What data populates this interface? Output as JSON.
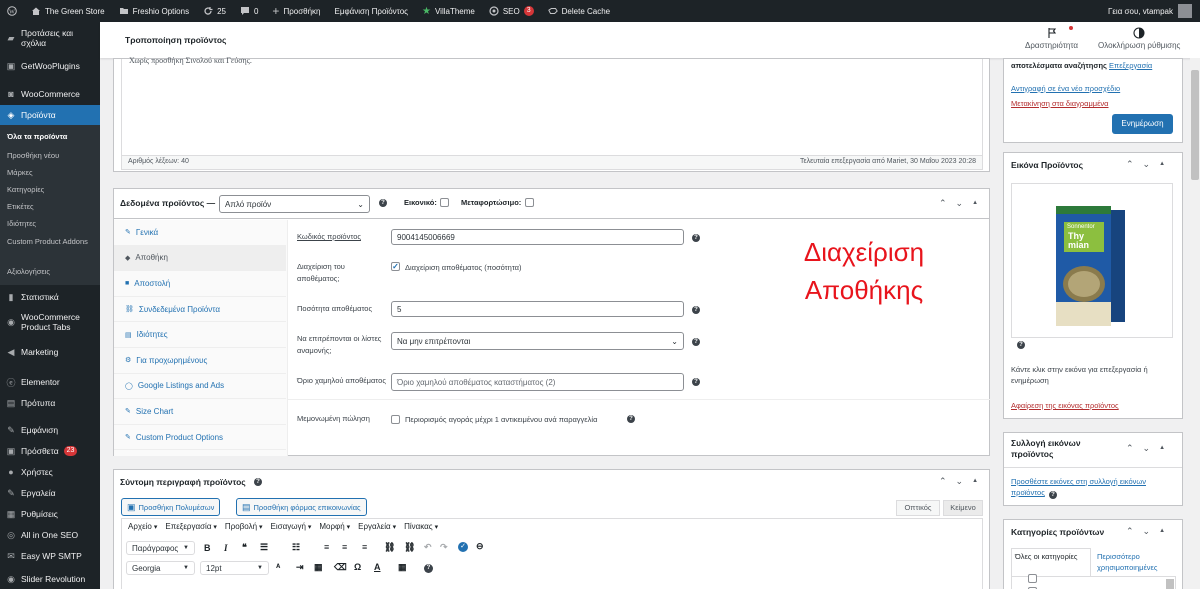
{
  "adminbar": {
    "site": "The Green Store",
    "freshio": "Freshio Options",
    "updates": "25",
    "comments": "0",
    "new": "Προσθήκη",
    "view": "Εμφάνιση Προϊόντος",
    "villa": "VillaTheme",
    "seo": "SEO",
    "seo_count": "3",
    "cache": "Delete Cache",
    "howdy": "Γεια σου, vtampak"
  },
  "sidebar": {
    "items": [
      {
        "label": "Προτάσεις και σχόλια",
        "icon": "comment-icon"
      },
      {
        "label": "GetWooPlugins",
        "icon": "plugin-icon"
      },
      {
        "label": "WooCommerce",
        "icon": "woo-icon"
      },
      {
        "label": "Προϊόντα",
        "icon": "products-icon"
      },
      {
        "label": "Στατιστικά",
        "icon": "chart-icon"
      },
      {
        "label": "WooCommerce Product Tabs",
        "icon": "tabs-icon"
      },
      {
        "label": "Marketing",
        "icon": "megaphone-icon"
      },
      {
        "label": "Elementor",
        "icon": "elementor-icon"
      },
      {
        "label": "Πρότυπα",
        "icon": "folder-icon"
      },
      {
        "label": "Εμφάνιση",
        "icon": "brush-icon"
      },
      {
        "label": "Πρόσθετα",
        "icon": "plugin-icon",
        "badge": "23"
      },
      {
        "label": "Χρήστες",
        "icon": "users-icon"
      },
      {
        "label": "Εργαλεία",
        "icon": "wrench-icon"
      },
      {
        "label": "Ρυθμίσεις",
        "icon": "settings-icon"
      },
      {
        "label": "All in One SEO",
        "icon": "seo-icon"
      },
      {
        "label": "Easy WP SMTP",
        "icon": "mail-icon"
      },
      {
        "label": "Slider Revolution",
        "icon": "slider-icon"
      }
    ],
    "submenu": [
      "Όλα τα προϊόντα",
      "Προσθήκη νέου",
      "Μάρκες",
      "Κατηγορίες",
      "Ετικέτες",
      "Ιδιότητες",
      "Custom Product Addons",
      "Αξιολογήσεις"
    ]
  },
  "header": {
    "title": "Τροποποίηση προϊόντος",
    "activity": "Δραστηριότητα",
    "completion": "Ολοκλήρωση ρύθμισης"
  },
  "editor": {
    "partial": "Χωρίς προσθήκη Σινολού και Γεύσης.",
    "wordcount": "Αριθμός λέξεων: 40",
    "lastedit": "Τελευταία επεξεργασία από Mariet, 30 Μαΐου 2023 20:28"
  },
  "productdata": {
    "title": "Δεδομένα προϊόντος —",
    "type": "Απλό προϊόν",
    "virtual": "Εικονικό:",
    "downloadable": "Μεταφορτώσιμο:",
    "tabs": [
      {
        "label": "Γενικά",
        "icon": "wrench-icon"
      },
      {
        "label": "Αποθήκη",
        "icon": "inventory-icon"
      },
      {
        "label": "Αποστολή",
        "icon": "truck-icon"
      },
      {
        "label": "Συνδεδεμένα Προϊόντα",
        "icon": "link-icon"
      },
      {
        "label": "Ιδιότητες",
        "icon": "list-icon"
      },
      {
        "label": "Για προχωρημένους",
        "icon": "gear-icon"
      },
      {
        "label": "Google Listings and Ads",
        "icon": "google-icon"
      },
      {
        "label": "Size Chart",
        "icon": "size-icon"
      },
      {
        "label": "Custom Product Options",
        "icon": "wrench-icon"
      }
    ],
    "sku_label": "Κωδικός προϊόντος",
    "sku": "9004145006669",
    "manage_label": "Διαχείριση του αποθέματος;",
    "manage_text": "Διαχείριση αποθέματος (ποσότητα)",
    "qty_label": "Ποσότητα αποθέματος",
    "qty": "5",
    "backorders_label": "Να επιτρέπονται οι λίστες αναμονής;",
    "backorders": "Να μην επιτρέπονται",
    "lowstock_label": "Όριο χαμηλού αποθέματος",
    "lowstock_placeholder": "Όριο χαμηλού αποθέματος καταστήματος (2)",
    "sold_label": "Μεμονωμένη πώληση",
    "sold_text": "Περιορισμός αγοράς μέχρι 1 αντικειμένου ανά παραγγελία",
    "annotation": "Διαχείριση Αποθήκης",
    "annotation_color": "#e8141c"
  },
  "shortdesc": {
    "title": "Σύντομη περιγραφή προϊόντος",
    "add_media": "Προσθήκη Πολυμέσων",
    "add_form": "Προσθήκη φόρμας επικοινωνίας",
    "tab_visual": "Οπτικός",
    "tab_text": "Κείμενο",
    "menus": [
      "Αρχείο",
      "Επεξεργασία",
      "Προβολή",
      "Εισαγωγή",
      "Μορφή",
      "Εργαλεία",
      "Πίνακας"
    ],
    "format": "Παράγραφος",
    "font": "Georgia",
    "size": "12pt"
  },
  "publish": {
    "partial": "αποτελέσματα αναζήτησης",
    "edit": "Επεξεργασία",
    "copy": "Αντιγραφή σε ένα νέο προσχέδιο",
    "trash": "Μετακίνηση στα διαγραμμένα",
    "update": "Ενημέρωση"
  },
  "image": {
    "title": "Εικόνα Προϊόντος",
    "package_brand": "Sonnentor",
    "package_name": "Thy mian",
    "hint": "Κάντε κλικ στην εικόνα για επεξεργασία ή ενημέρωση",
    "remove": "Αφαίρεση της εικόνας προϊόντος"
  },
  "gallery": {
    "title": "Συλλογή εικόνων προϊόντος",
    "add": "Προσθέστε εικόνες στη συλλογή εικόνων προϊόντος"
  },
  "categories": {
    "title": "Κατηγορίες προϊόντων",
    "tab_all": "Όλες οι κατηγορίες",
    "tab_used": "Περισσότερο χρησιμοποιημένες"
  },
  "colors": {
    "admin_dark": "#1d2327",
    "accent": "#2271b1",
    "danger": "#d63638"
  }
}
